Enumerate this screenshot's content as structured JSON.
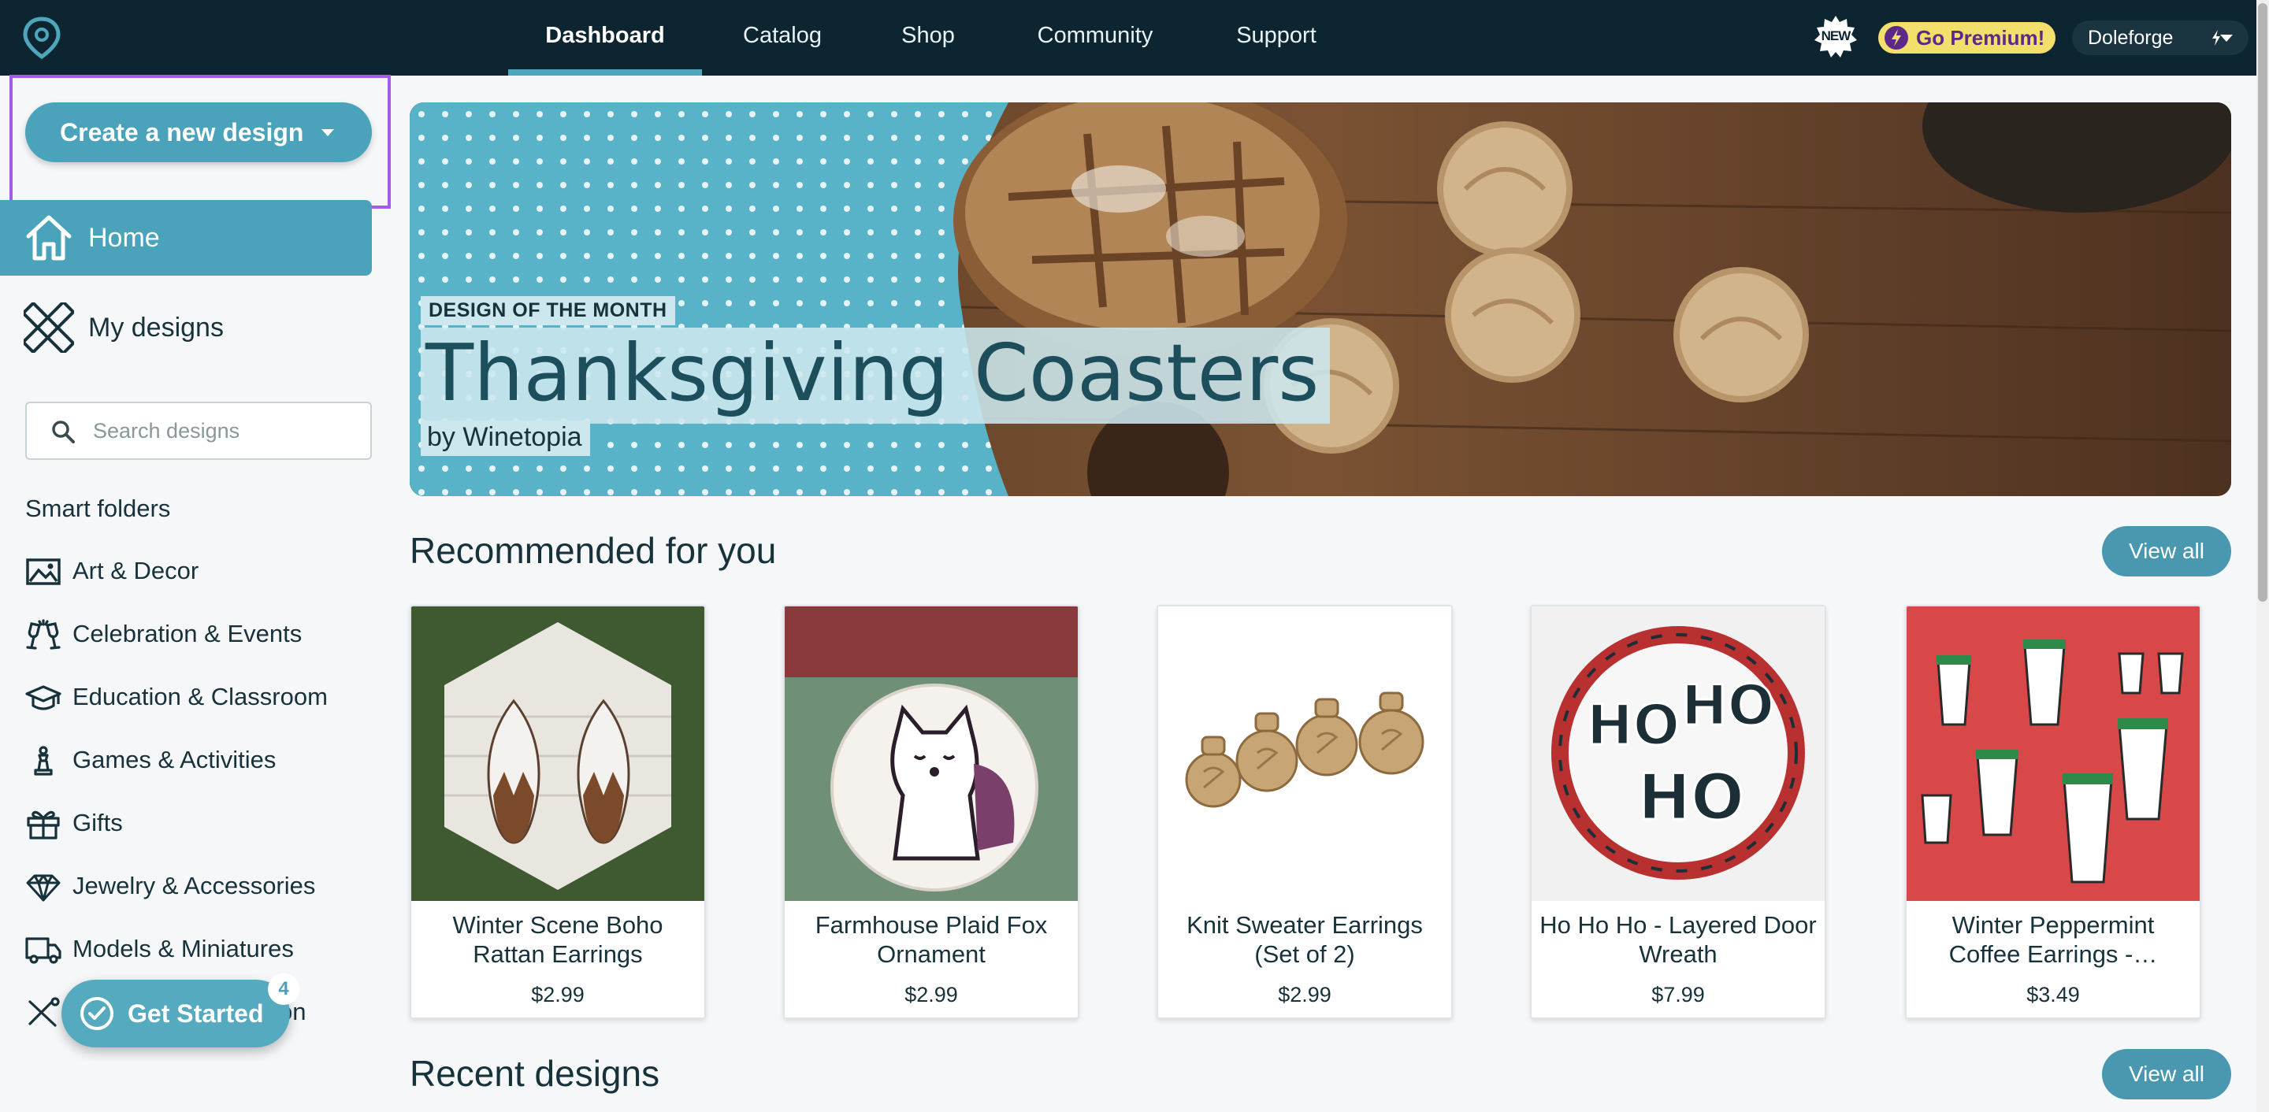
{
  "nav": {
    "tabs": [
      "Dashboard",
      "Catalog",
      "Shop",
      "Community",
      "Support"
    ],
    "new_badge": "NEW",
    "premium_label": "Go Premium!",
    "user_label": "Doleforge"
  },
  "sidebar": {
    "create_label": "Create a new design",
    "home_label": "Home",
    "my_designs_label": "My designs",
    "search_placeholder": "Search designs",
    "smart_folders_title": "Smart folders",
    "folders": [
      {
        "label": "Art & Decor",
        "icon": "image-icon"
      },
      {
        "label": "Celebration & Events",
        "icon": "champagne-icon"
      },
      {
        "label": "Education & Classroom",
        "icon": "graduation-cap-icon"
      },
      {
        "label": "Games & Activities",
        "icon": "chess-piece-icon"
      },
      {
        "label": "Gifts",
        "icon": "gift-icon"
      },
      {
        "label": "Jewelry & Accessories",
        "icon": "diamond-icon"
      },
      {
        "label": "Models & Miniatures",
        "icon": "truck-icon"
      },
      {
        "label": "on",
        "icon": "tools-icon"
      }
    ],
    "get_started_label": "Get Started",
    "get_started_count": "4"
  },
  "hero": {
    "tag": "DESIGN OF THE MONTH",
    "title": "Thanksgiving Coasters",
    "byline": "by Winetopia"
  },
  "recommended": {
    "title": "Recommended for you",
    "view_all": "View all",
    "items": [
      {
        "name": "Winter Scene Boho Rattan Earrings",
        "price": "$2.99"
      },
      {
        "name": "Farmhouse Plaid Fox Ornament",
        "price": "$2.99"
      },
      {
        "name": "Knit Sweater Earrings (Set of 2)",
        "price": "$2.99"
      },
      {
        "name": "Ho Ho Ho - Layered Door Wreath",
        "price": "$7.99"
      },
      {
        "name": "Winter Peppermint Coffee Earrings -…",
        "price": "$3.49"
      }
    ]
  },
  "recent": {
    "title": "Recent designs",
    "view_all": "View all"
  },
  "colors": {
    "topbar": "#0d2530",
    "accent": "#4aa3ba",
    "focus_outline": "#a55de8",
    "premium_bg": "#f3df6b"
  }
}
